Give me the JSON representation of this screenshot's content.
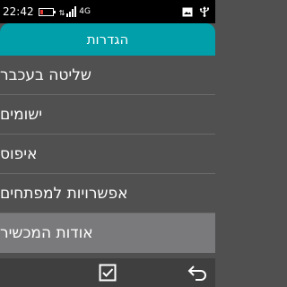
{
  "status_bar": {
    "time": "22:42",
    "network_type": "4G",
    "battery_level": 0.2,
    "battery_color": "#e53935",
    "icons_right": [
      "image-icon",
      "usb-icon"
    ]
  },
  "header": {
    "title": "הגדרות",
    "color": "#009faa"
  },
  "menu": {
    "items": [
      {
        "label": "שליטה בעכבר"
      },
      {
        "label": "ישומים"
      },
      {
        "label": "איפוס"
      },
      {
        "label": "אפשרויות למפתחים"
      },
      {
        "label": "אודות המכשיר",
        "selected": true
      }
    ]
  },
  "softkeys": {
    "center_icon": "checkbox-icon",
    "right_icon": "back-arrow-icon"
  }
}
